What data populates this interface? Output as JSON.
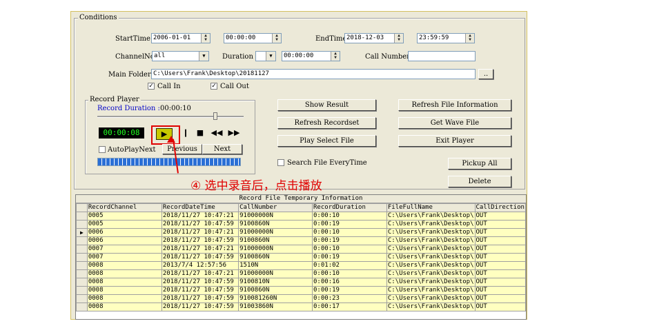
{
  "conditions": {
    "title": "Conditions",
    "start_time_label": "StartTime",
    "start_date": "2006-01-01",
    "start_clock": "00:00:00",
    "end_time_label": "EndTime",
    "end_date": "2018-12-03",
    "end_clock": "23:59:59",
    "channel_label": "ChannelNo",
    "channel_value": "all",
    "duration_label": "Duration",
    "duration_op": "",
    "duration_value": "00:00:00",
    "call_number_label": "Call Number",
    "call_number_value": "",
    "main_folder_label": "Main Folder",
    "main_folder_value": "C:\\Users\\Frank\\Desktop\\20181127",
    "browse_label": "..",
    "call_in_label": "Call In",
    "call_out_label": "Call Out"
  },
  "player": {
    "title": "Record Player",
    "duration_label": "Record Duration :",
    "duration_value": "00:00:10",
    "time_display": "00:00:08",
    "autoplay_label": "AutoPlayNext",
    "previous_label": "Previous",
    "next_label": "Next",
    "progress": 1.0
  },
  "buttons": {
    "show_result": "Show Result",
    "refresh_recordset": "Refresh Recordset",
    "play_select_file": "Play Select File",
    "refresh_file_info": "Refresh File Information",
    "get_wave_file": "Get Wave File",
    "exit_player": "Exit Player",
    "search_every_time": "Search File EveryTime",
    "pickup_all": "Pickup All",
    "delete": "Delete"
  },
  "annotation": {
    "text": "④  选中录音后，点击播放",
    "color": "#e00000"
  },
  "table": {
    "title": "Record File Temporary Information",
    "columns": [
      "RecordChannel",
      "RecordDateTime",
      "CallNumber",
      "RecordDuration",
      "FileFullName",
      "CallDirection"
    ],
    "rows": [
      [
        "0005",
        "2018/11/27 10:47:21",
        "91000000N",
        "0:00:10",
        "C:\\Users\\Frank\\Desktop\\",
        "OUT"
      ],
      [
        "0005",
        "2018/11/27 10:47:59",
        "9100860N",
        "0:00:19",
        "C:\\Users\\Frank\\Desktop\\",
        "OUT"
      ],
      [
        "0006",
        "2018/11/27 10:47:21",
        "91000000N",
        "0:00:10",
        "C:\\Users\\Frank\\Desktop\\",
        "OUT"
      ],
      [
        "0006",
        "2018/11/27 10:47:59",
        "9100860N",
        "0:00:19",
        "C:\\Users\\Frank\\Desktop\\",
        "OUT"
      ],
      [
        "0007",
        "2018/11/27 10:47:21",
        "91000000N",
        "0:00:10",
        "C:\\Users\\Frank\\Desktop\\",
        "OUT"
      ],
      [
        "0007",
        "2018/11/27 10:47:59",
        "9100860N",
        "0:00:19",
        "C:\\Users\\Frank\\Desktop\\",
        "OUT"
      ],
      [
        "0008",
        "2013/7/4 12:57:56",
        "1510N",
        "0:01:02",
        "C:\\Users\\Frank\\Desktop\\",
        "OUT"
      ],
      [
        "0008",
        "2018/11/27 10:47:21",
        "91000000N",
        "0:00:10",
        "C:\\Users\\Frank\\Desktop\\",
        "OUT"
      ],
      [
        "0008",
        "2018/11/27 10:47:59",
        "9100810N",
        "0:00:16",
        "C:\\Users\\Frank\\Desktop\\",
        "OUT"
      ],
      [
        "0008",
        "2018/11/27 10:47:59",
        "9100860N",
        "0:00:19",
        "C:\\Users\\Frank\\Desktop\\",
        "OUT"
      ],
      [
        "0008",
        "2018/11/27 10:47:59",
        "910081260N",
        "0:00:23",
        "C:\\Users\\Frank\\Desktop\\",
        "OUT"
      ],
      [
        "0008",
        "2018/11/27 10:47:59",
        "91003860N",
        "0:00:17",
        "C:\\Users\\Frank\\Desktop\\",
        "OUT"
      ]
    ],
    "selected_row": 2
  }
}
